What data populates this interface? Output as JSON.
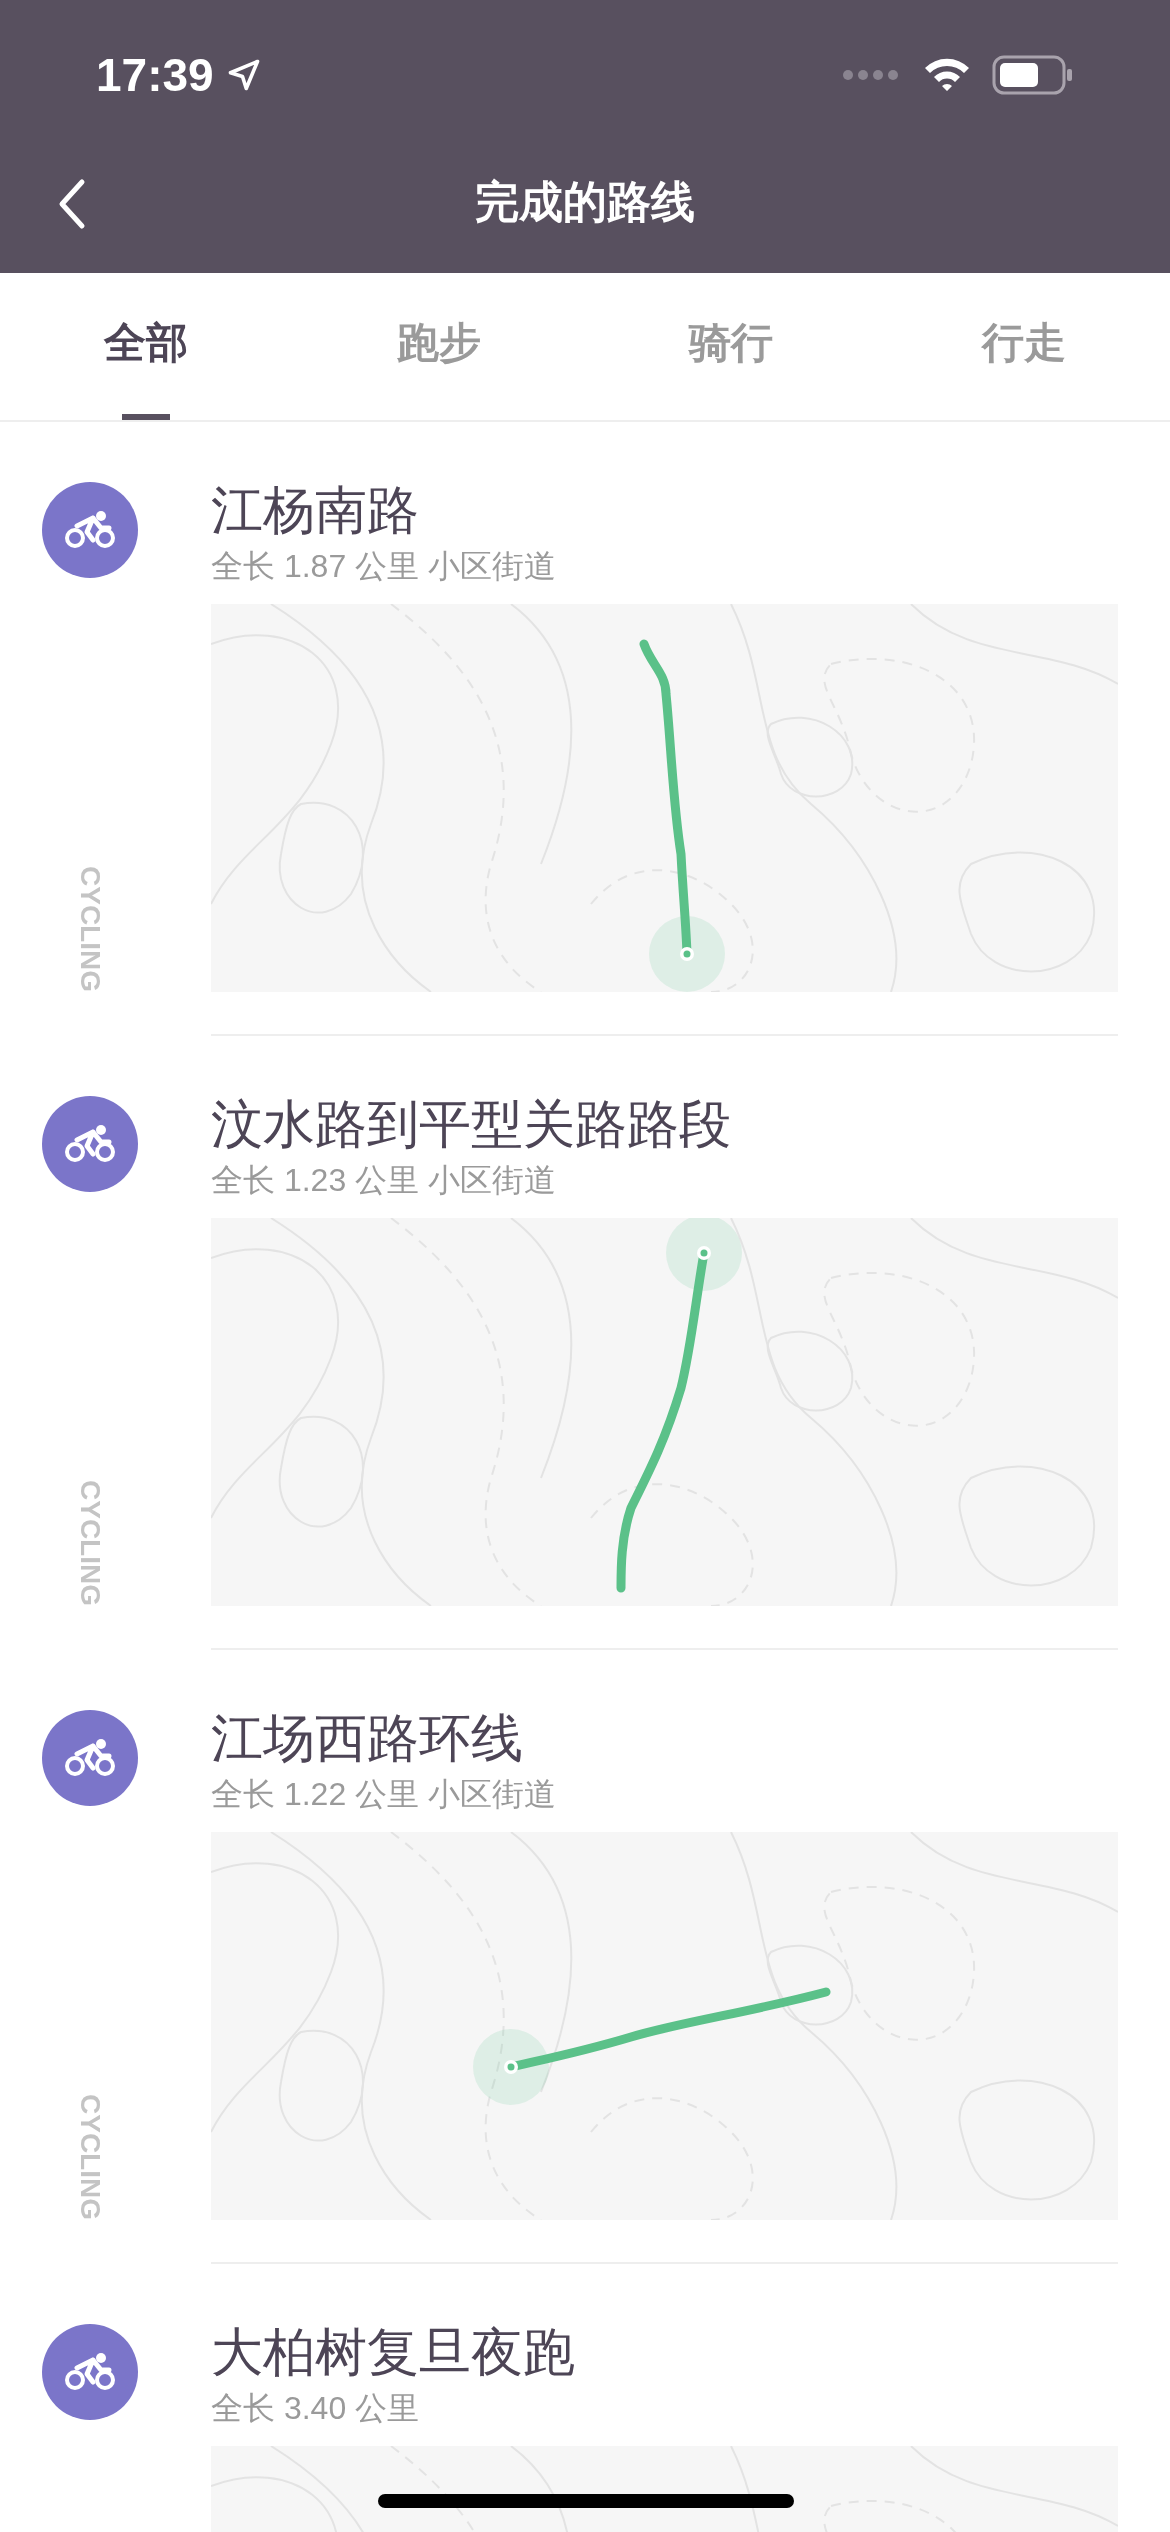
{
  "status_bar": {
    "time": "17:39"
  },
  "header": {
    "title": "完成的路线"
  },
  "tabs": [
    {
      "label": "全部",
      "selected": true
    },
    {
      "label": "跑步",
      "selected": false
    },
    {
      "label": "骑行",
      "selected": false
    },
    {
      "label": "行走",
      "selected": false
    }
  ],
  "routes": [
    {
      "title": "江杨南路",
      "subtitle": "全长 1.87 公里 小区街道",
      "sport_label": "CYCLING"
    },
    {
      "title": "汶水路到平型关路路段",
      "subtitle": "全长 1.23 公里 小区街道",
      "sport_label": "CYCLING"
    },
    {
      "title": "江场西路环线",
      "subtitle": "全长 1.22 公里 小区街道",
      "sport_label": "CYCLING"
    },
    {
      "title": "大柏树复旦夜跑",
      "subtitle": "全长 3.40 公里"
    }
  ]
}
